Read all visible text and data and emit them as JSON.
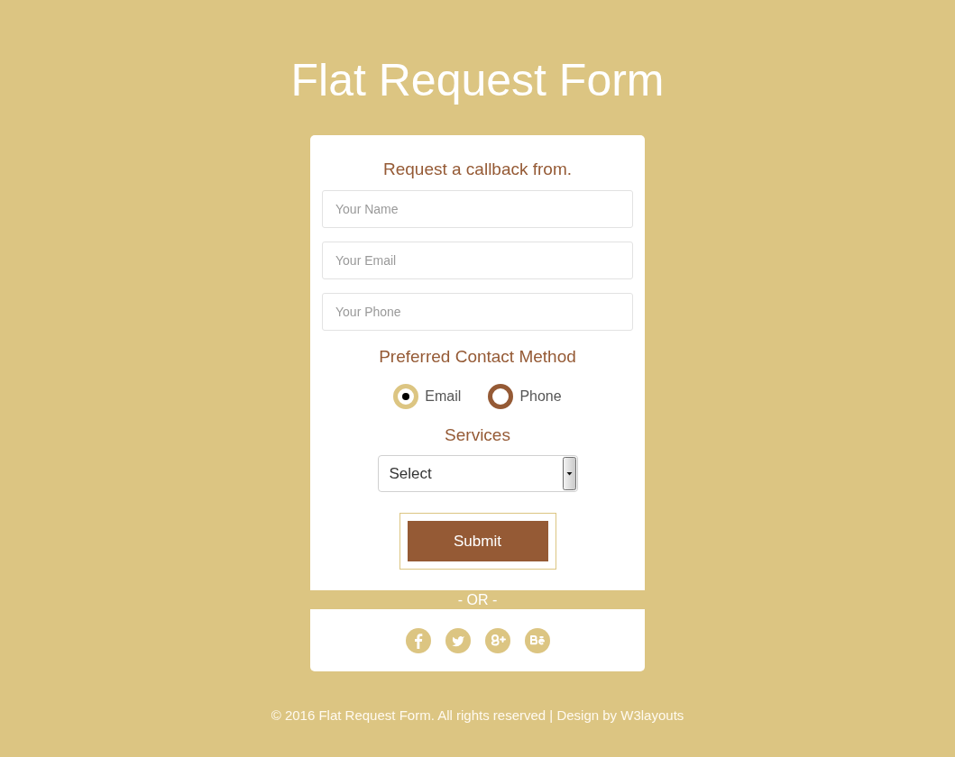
{
  "page_title": "Flat Request Form",
  "form": {
    "heading": "Request a callback from.",
    "fields": [
      {
        "placeholder": "Your Name"
      },
      {
        "placeholder": "Your Email"
      },
      {
        "placeholder": "Your Phone"
      }
    ],
    "contact_method": {
      "label": "Preferred Contact Method",
      "options": [
        {
          "label": "Email",
          "selected": true
        },
        {
          "label": "Phone",
          "selected": false
        }
      ]
    },
    "services": {
      "label": "Services",
      "select": {
        "value": "Select"
      }
    },
    "submit": {
      "label": "Submit"
    }
  },
  "divider": {
    "text": "- OR -"
  },
  "social": [
    {
      "kind": "facebook"
    },
    {
      "kind": "twitter"
    },
    {
      "kind": "google-plus"
    },
    {
      "kind": "behance"
    }
  ],
  "footer": {
    "text": "© 2016 Flat Request Form. All rights reserved | Design by W3layouts"
  }
}
